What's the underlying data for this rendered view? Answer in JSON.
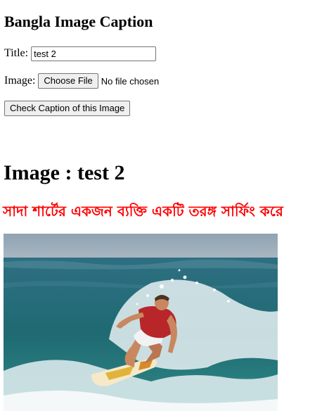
{
  "header": {
    "title": "Bangla Image Caption"
  },
  "form": {
    "title_label": "Title:",
    "title_value": "test 2",
    "image_label": "Image:",
    "choose_file_label": "Choose File",
    "file_status": "No file chosen",
    "submit_label": "Check Caption of this Image"
  },
  "result": {
    "heading": "Image : test 2",
    "caption": "সাদা শার্টের একজন ব্যক্তি একটি তরঙ্গ সার্ফিং করে",
    "caption_color": "#ff0000"
  }
}
